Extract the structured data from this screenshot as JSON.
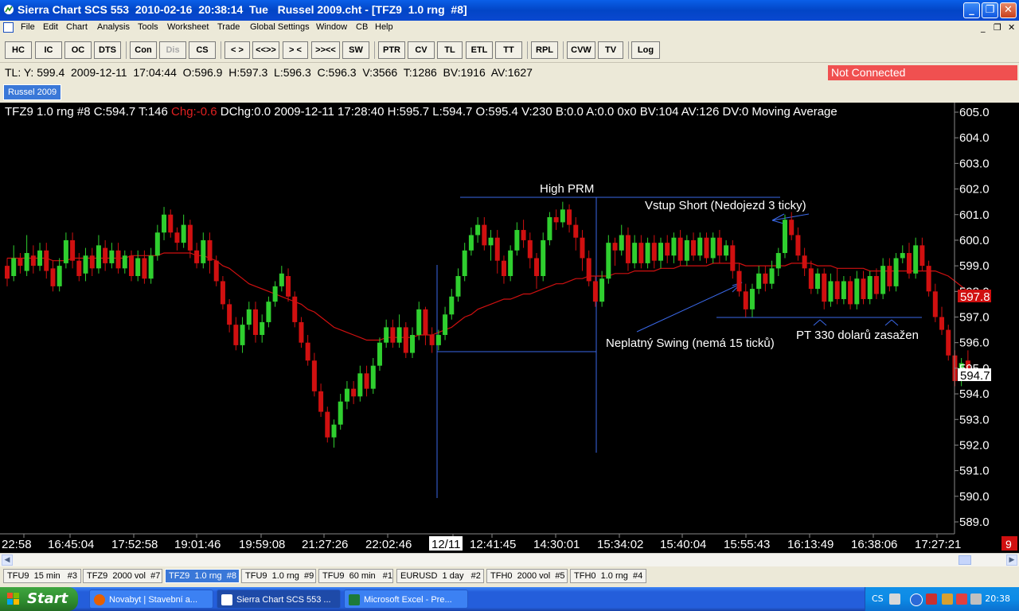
{
  "window": {
    "title": "Sierra Chart SCS 553  2010-02-16  20:38:14  Tue   Russel 2009.cht - [TFZ9  1.0 rng  #8]",
    "min_label": "_",
    "max_label": "❐",
    "close_label": "✕"
  },
  "menu": {
    "items": [
      "File",
      "Edit",
      "Chart",
      "Analysis",
      "Tools",
      "Worksheet",
      "Trade",
      "Global Settings",
      "Window",
      "CB",
      "Help"
    ],
    "mdi_min": "_",
    "mdi_restore": "❐",
    "mdi_close": "✕"
  },
  "toolbar": {
    "buttons": [
      "HC",
      "IC",
      "OC",
      "DTS",
      "Con",
      "Dis",
      "CS",
      "< >",
      "<<>>",
      "> <",
      ">><<",
      "SW",
      "PTR",
      "CV",
      "TL",
      "ETL",
      "TT",
      "RPL",
      "CVW",
      "TV",
      "Log"
    ],
    "disabled": [
      "Dis"
    ]
  },
  "infoline": {
    "text": "TL: Y: 599.4  2009-12-11  17:04:44  O:596.9  H:597.3  L:596.3  C:596.3  V:3566  T:1286  BV:1916  AV:1627",
    "connection_status": "Not Connected"
  },
  "chartbook": {
    "tab": "Russel 2009"
  },
  "chart": {
    "header_prefix": "TFZ9  1.0 rng  #8  C:594.7  T:146 ",
    "header_change": "Chg:-0.6",
    "header_rest": "  DChg:0.0  2009-12-11  17:28:40  H:595.7  L:594.7  O:595.4  V:230  B:0.0  A:0.0  0x0   BV:104  AV:126  DV:0  Moving Average",
    "price_labels": [
      "605.0",
      "604.0",
      "603.0",
      "602.0",
      "601.0",
      "600.0",
      "599.0",
      "598.0",
      "597.0",
      "596.0",
      "595.0",
      "594.0",
      "593.0",
      "592.0",
      "591.0",
      "590.0",
      "589.0"
    ],
    "ma_price_box": "597.8",
    "last_price_box": "594.7",
    "time_labels": [
      "22:58",
      "16:45:04",
      "17:52:58",
      "19:01:46",
      "19:59:08",
      "21:27:26",
      "22:02:46",
      "12/11",
      "12:41:45",
      "14:30:01",
      "15:34:02",
      "15:40:04",
      "15:55:43",
      "16:13:49",
      "16:38:06",
      "17:27:21"
    ],
    "corner_value": "9",
    "annotations": {
      "high_prm": "High PRM",
      "vstup": "Vstup Short (Nedojezd 3 ticky)",
      "neplatny": "Neplatný Swing (nemá 15 ticků)",
      "pt": "PT 330 dolarů zasažen"
    },
    "colors": {
      "up": "#2fcf2f",
      "down": "#d01010",
      "ma": "#d01010",
      "lines": "#3a68e8",
      "background": "#000000"
    }
  },
  "chart_data": {
    "type": "candlestick",
    "title": "",
    "ylim": [
      589.0,
      605.0
    ],
    "series": [
      {
        "name": "TFZ9 1.0 rng #8",
        "bars": [
          [
            599.0,
            598.5,
            599.3,
            598.2
          ],
          [
            598.6,
            599.3,
            599.8,
            598.4
          ],
          [
            599.3,
            599.0,
            599.5,
            598.7
          ],
          [
            598.8,
            599.5,
            600.2,
            598.6
          ],
          [
            599.4,
            599.0,
            599.8,
            598.7
          ],
          [
            599.0,
            599.6,
            599.9,
            598.8
          ],
          [
            599.6,
            598.8,
            599.9,
            598.5
          ],
          [
            598.9,
            598.2,
            599.2,
            598.0
          ],
          [
            598.2,
            599.0,
            599.3,
            598.0
          ],
          [
            599.1,
            600.0,
            600.3,
            598.9
          ],
          [
            600.0,
            599.2,
            600.3,
            598.9
          ],
          [
            599.2,
            598.6,
            599.5,
            598.4
          ],
          [
            598.7,
            599.4,
            599.7,
            598.4
          ],
          [
            599.4,
            598.9,
            599.7,
            598.6
          ],
          [
            598.9,
            599.8,
            600.2,
            598.7
          ],
          [
            599.7,
            599.1,
            600.0,
            598.8
          ],
          [
            599.1,
            599.6,
            599.9,
            598.9
          ],
          [
            599.6,
            598.9,
            599.9,
            598.7
          ],
          [
            598.9,
            599.4,
            599.6,
            598.7
          ],
          [
            599.4,
            598.6,
            599.6,
            598.4
          ],
          [
            598.6,
            599.3,
            599.6,
            598.4
          ],
          [
            599.3,
            598.5,
            599.6,
            598.3
          ],
          [
            598.5,
            599.4,
            599.7,
            598.3
          ],
          [
            599.4,
            600.3,
            600.6,
            599.2
          ],
          [
            600.3,
            601.0,
            601.3,
            600.0
          ],
          [
            601.0,
            600.3,
            601.2,
            600.1
          ],
          [
            600.3,
            599.9,
            600.5,
            599.6
          ],
          [
            599.9,
            600.6,
            601.0,
            599.7
          ],
          [
            600.6,
            599.6,
            600.8,
            599.3
          ],
          [
            599.6,
            599.1,
            599.9,
            598.9
          ],
          [
            599.1,
            600.0,
            600.3,
            598.9
          ],
          [
            600.0,
            599.2,
            600.3,
            598.7
          ],
          [
            599.2,
            598.4,
            599.4,
            598.2
          ],
          [
            598.4,
            597.5,
            598.6,
            597.3
          ],
          [
            597.5,
            596.7,
            597.7,
            596.4
          ],
          [
            596.7,
            595.9,
            597.0,
            595.7
          ],
          [
            595.9,
            596.7,
            597.0,
            595.6
          ],
          [
            596.7,
            597.3,
            597.6,
            596.5
          ],
          [
            597.3,
            596.3,
            597.6,
            596.0
          ],
          [
            596.3,
            596.8,
            597.1,
            596.0
          ],
          [
            596.8,
            597.6,
            597.8,
            596.6
          ],
          [
            597.6,
            598.2,
            598.4,
            597.4
          ],
          [
            598.2,
            598.7,
            599.0,
            598.0
          ],
          [
            598.6,
            597.8,
            598.9,
            597.6
          ],
          [
            597.8,
            596.8,
            598.0,
            596.6
          ],
          [
            596.8,
            596.0,
            597.0,
            595.8
          ],
          [
            596.0,
            595.3,
            596.3,
            595.1
          ],
          [
            595.3,
            594.1,
            595.6,
            593.9
          ],
          [
            594.1,
            593.3,
            594.4,
            593.1
          ],
          [
            593.3,
            592.3,
            593.5,
            592.1
          ],
          [
            592.3,
            592.8,
            593.0,
            591.9
          ],
          [
            592.8,
            593.7,
            594.0,
            592.6
          ],
          [
            593.7,
            594.2,
            594.5,
            593.4
          ],
          [
            594.2,
            593.9,
            594.5,
            593.6
          ],
          [
            593.9,
            594.8,
            595.1,
            593.7
          ],
          [
            594.8,
            594.2,
            595.1,
            593.9
          ],
          [
            594.2,
            595.1,
            595.4,
            594.0
          ],
          [
            595.1,
            596.0,
            596.2,
            594.9
          ],
          [
            596.0,
            596.6,
            596.9,
            595.8
          ],
          [
            596.6,
            596.0,
            596.9,
            595.8
          ],
          [
            596.0,
            596.6,
            597.1,
            595.8
          ],
          [
            596.6,
            595.6,
            596.8,
            595.4
          ],
          [
            595.6,
            596.3,
            596.6,
            595.4
          ],
          [
            596.3,
            597.3,
            597.6,
            596.1
          ],
          [
            597.3,
            596.3,
            597.4,
            595.9
          ],
          [
            596.3,
            595.9,
            596.6,
            595.6
          ],
          [
            595.9,
            596.3,
            596.5,
            595.7
          ],
          [
            596.3,
            597.1,
            597.4,
            596.1
          ],
          [
            597.1,
            597.8,
            598.1,
            596.9
          ],
          [
            597.8,
            598.6,
            598.9,
            597.6
          ],
          [
            598.6,
            599.6,
            599.9,
            598.4
          ],
          [
            599.6,
            600.2,
            600.5,
            599.4
          ],
          [
            600.2,
            600.6,
            600.9,
            599.9
          ],
          [
            600.6,
            599.8,
            600.9,
            599.6
          ],
          [
            599.8,
            600.1,
            600.4,
            599.2
          ],
          [
            600.1,
            599.2,
            600.4,
            598.7
          ],
          [
            599.2,
            598.6,
            599.4,
            598.3
          ],
          [
            598.6,
            599.6,
            599.8,
            598.4
          ],
          [
            599.6,
            600.4,
            600.7,
            599.4
          ],
          [
            600.4,
            600.0,
            600.8,
            599.7
          ],
          [
            600.0,
            599.3,
            600.3,
            598.9
          ],
          [
            599.3,
            598.6,
            599.5,
            598.1
          ],
          [
            598.6,
            600.0,
            600.3,
            598.4
          ],
          [
            600.0,
            600.9,
            601.1,
            599.8
          ],
          [
            600.9,
            600.7,
            601.2,
            600.4
          ],
          [
            600.7,
            601.2,
            601.5,
            600.5
          ],
          [
            601.2,
            600.6,
            601.4,
            600.3
          ],
          [
            600.6,
            600.1,
            600.9,
            599.6
          ],
          [
            600.1,
            599.3,
            600.4,
            598.8
          ],
          [
            599.3,
            598.4,
            599.6,
            598.2
          ],
          [
            598.4,
            597.6,
            598.6,
            597.4
          ],
          [
            597.6,
            598.5,
            598.8,
            597.4
          ],
          [
            598.5,
            599.9,
            600.2,
            598.3
          ],
          [
            599.9,
            599.6,
            600.1,
            599.0
          ],
          [
            599.6,
            600.2,
            600.6,
            599.4
          ],
          [
            600.2,
            599.1,
            600.5,
            598.8
          ],
          [
            599.1,
            599.9,
            600.2,
            598.9
          ],
          [
            599.9,
            599.1,
            600.2,
            598.9
          ],
          [
            599.1,
            599.9,
            600.1,
            598.9
          ],
          [
            599.9,
            599.2,
            600.2,
            598.9
          ],
          [
            599.2,
            599.9,
            600.1,
            598.9
          ],
          [
            599.9,
            599.4,
            600.2,
            599.1
          ],
          [
            599.4,
            600.1,
            600.3,
            599.1
          ],
          [
            600.1,
            599.2,
            600.4,
            599.0
          ],
          [
            599.2,
            600.0,
            600.2,
            599.0
          ],
          [
            600.0,
            599.4,
            600.3,
            599.2
          ],
          [
            599.4,
            600.1,
            600.3,
            599.2
          ],
          [
            600.1,
            599.3,
            600.3,
            599.1
          ],
          [
            599.3,
            600.1,
            600.3,
            599.1
          ],
          [
            600.1,
            599.4,
            600.4,
            599.1
          ],
          [
            599.4,
            599.8,
            600.0,
            599.2
          ],
          [
            599.8,
            598.8,
            600.0,
            598.5
          ],
          [
            598.8,
            598.0,
            599.1,
            597.8
          ],
          [
            598.0,
            597.3,
            598.3,
            597.0
          ],
          [
            597.3,
            598.1,
            598.3,
            597.0
          ],
          [
            598.1,
            598.7,
            599.0,
            597.9
          ],
          [
            598.7,
            598.3,
            599.0,
            598.0
          ],
          [
            598.3,
            598.9,
            599.2,
            598.1
          ],
          [
            598.9,
            599.5,
            599.7,
            598.6
          ],
          [
            599.5,
            600.8,
            601.0,
            599.3
          ],
          [
            600.8,
            600.2,
            601.1,
            600.0
          ],
          [
            600.2,
            599.4,
            600.5,
            599.2
          ],
          [
            599.4,
            598.9,
            599.7,
            598.6
          ],
          [
            598.9,
            598.1,
            599.2,
            597.9
          ],
          [
            598.1,
            598.7,
            598.9,
            597.9
          ],
          [
            598.7,
            597.6,
            598.9,
            597.3
          ],
          [
            597.6,
            598.4,
            598.7,
            597.4
          ],
          [
            598.4,
            597.7,
            598.9,
            597.5
          ],
          [
            597.7,
            598.4,
            598.6,
            597.5
          ],
          [
            598.4,
            597.5,
            598.6,
            597.3
          ],
          [
            597.5,
            598.5,
            598.8,
            597.3
          ],
          [
            598.5,
            597.7,
            598.8,
            597.5
          ],
          [
            597.7,
            598.6,
            598.8,
            597.5
          ],
          [
            598.6,
            597.9,
            598.9,
            597.7
          ],
          [
            597.9,
            599.0,
            599.3,
            597.7
          ],
          [
            599.0,
            598.2,
            599.3,
            598.0
          ],
          [
            598.2,
            599.3,
            599.5,
            598.0
          ],
          [
            599.3,
            599.5,
            599.8,
            599.1
          ],
          [
            599.5,
            598.7,
            599.9,
            598.5
          ],
          [
            598.7,
            599.8,
            600.1,
            598.5
          ],
          [
            599.8,
            599.0,
            600.1,
            598.8
          ],
          [
            599.0,
            598.0,
            599.2,
            597.8
          ],
          [
            598.0,
            597.0,
            598.3,
            596.8
          ],
          [
            597.0,
            596.5,
            597.4,
            596.3
          ],
          [
            596.5,
            595.5,
            596.7,
            595.3
          ],
          [
            595.5,
            594.5,
            595.7,
            594.3
          ],
          [
            594.5,
            595.2,
            595.4,
            594.3
          ],
          [
            595.3,
            594.7,
            595.7,
            594.5
          ]
        ]
      }
    ],
    "moving_average": [
      599.3,
      599.3,
      599.3,
      599.3,
      599.3,
      599.3,
      599.3,
      599.2,
      599.2,
      599.2,
      599.3,
      599.3,
      599.3,
      599.3,
      599.3,
      599.3,
      599.3,
      599.3,
      599.3,
      599.4,
      599.4,
      599.4,
      599.4,
      599.4,
      599.5,
      599.5,
      599.5,
      599.5,
      599.5,
      599.4,
      599.4,
      599.3,
      599.2,
      599.0,
      598.9,
      598.7,
      598.5,
      598.3,
      598.2,
      598.1,
      598.0,
      597.9,
      597.8,
      597.7,
      597.6,
      597.5,
      597.3,
      597.2,
      597.0,
      596.8,
      596.6,
      596.5,
      596.4,
      596.3,
      596.2,
      596.1,
      596.1,
      596.1,
      596.2,
      596.2,
      596.2,
      596.2,
      596.2,
      596.3,
      596.3,
      596.3,
      596.4,
      596.5,
      596.6,
      596.8,
      597.0,
      597.1,
      597.3,
      597.4,
      597.5,
      597.6,
      597.7,
      597.7,
      597.8,
      597.9,
      597.9,
      598.0,
      598.1,
      598.2,
      598.3,
      598.3,
      598.4,
      598.5,
      598.5,
      598.6,
      598.6,
      598.6,
      598.6,
      598.7,
      598.7,
      598.7,
      598.8,
      598.8,
      598.8,
      598.8,
      598.9,
      598.9,
      598.9,
      599.0,
      599.0,
      599.0,
      599.0,
      599.0,
      599.1,
      599.1,
      599.1,
      599.1,
      599.1,
      599.0,
      599.0,
      599.0,
      599.0,
      599.0,
      599.0,
      599.0,
      599.1,
      599.1,
      599.1,
      599.1,
      599.0,
      599.0,
      599.0,
      598.9,
      598.9,
      598.9,
      598.9,
      598.9,
      598.8,
      598.8,
      598.8,
      598.8,
      598.8,
      598.8,
      598.8,
      598.8,
      598.8,
      598.8,
      598.8,
      598.7,
      598.6,
      598.4,
      598.2,
      598.0
    ]
  },
  "chart_tabs": {
    "items": [
      "TFU9  15 min   #3",
      "TFZ9  2000 vol  #7",
      "TFZ9  1.0 rng  #8",
      "TFU9  1.0 rng  #9",
      "TFU9  60 min   #1",
      "EURUSD  1 day   #2",
      "TFH0  2000 vol  #5",
      "TFH0  1.0 rng  #4"
    ],
    "active_index": 2
  },
  "taskbar": {
    "start_label": "Start",
    "tasks": [
      "Novabyt | Stavební a...",
      "Sierra Chart SCS 553 ...",
      "Microsoft Excel - Pre..."
    ],
    "active_task": 1,
    "language": "CS",
    "clock": "20:38"
  }
}
